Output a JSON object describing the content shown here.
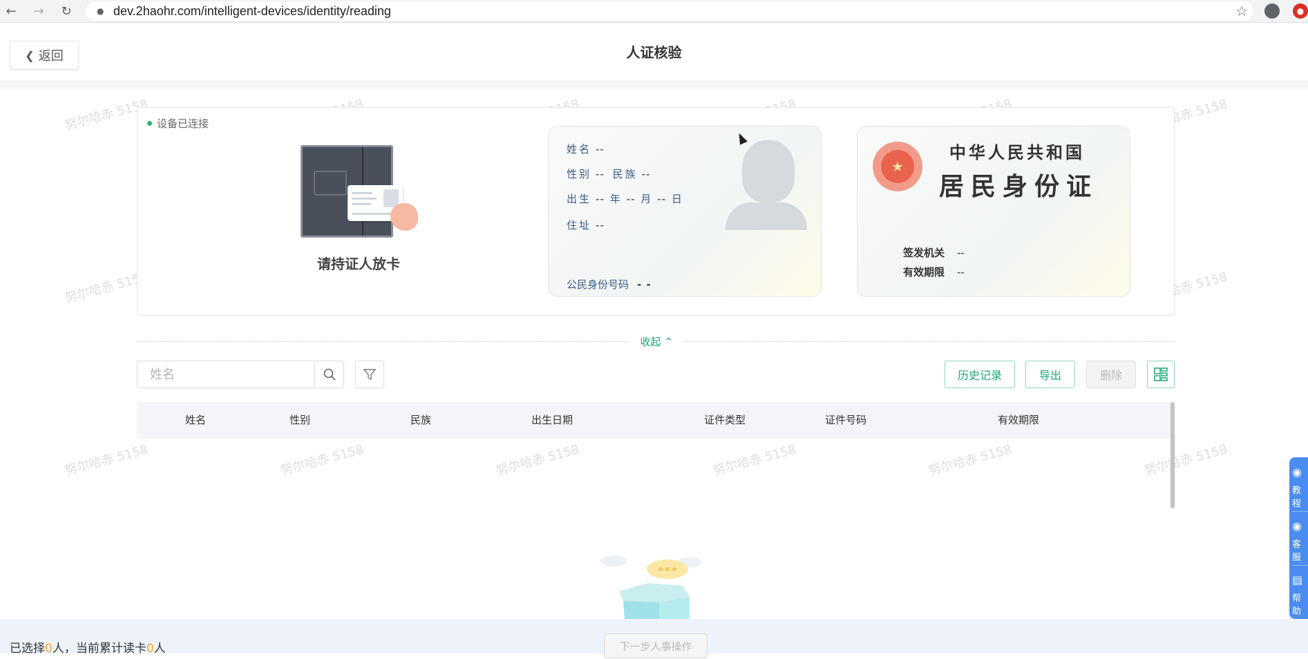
{
  "browser": {
    "url": "dev.2haohr.com/intelligent-devices/identity/reading",
    "back_icon": "arrow-left-icon",
    "forward_icon": "arrow-right-icon",
    "reload_icon": "reload-icon",
    "star_icon": "star-icon"
  },
  "header": {
    "back_label": "返回",
    "title": "人证核验"
  },
  "watermark": "努尔哈赤 5158",
  "reader": {
    "device_status": "设备已连接",
    "place_card_tip": "请持证人放卡",
    "front": {
      "name_label": "姓名",
      "name_value": "--",
      "gender_label": "性别",
      "gender_value": "--",
      "ethnicity_label": "民族",
      "ethnicity_value": "--",
      "birth_label": "出生",
      "birth_year": "--",
      "year_unit": "年",
      "birth_month": "--",
      "month_unit": "月",
      "birth_day": "--",
      "day_unit": "日",
      "address_label": "住址",
      "address_value": "--",
      "id_label": "公民身份号码",
      "id_value": "- -"
    },
    "back": {
      "country": "中华人民共和国",
      "card_title": "居民身份证",
      "authority_label": "签发机关",
      "authority_value": "--",
      "validity_label": "有效期限",
      "validity_value": "--"
    }
  },
  "collapse_label": "收起",
  "toolbar": {
    "search_placeholder": "姓名",
    "history_label": "历史记录",
    "export_label": "导出",
    "delete_label": "删除"
  },
  "table": {
    "columns": [
      "姓名",
      "性别",
      "民族",
      "出生日期",
      "证件类型",
      "证件号码",
      "有效期限"
    ]
  },
  "footer": {
    "selected_prefix": "已选择",
    "selected_count": "0",
    "selected_unit": "人，当前累计读卡",
    "read_count": "0",
    "read_unit": "人",
    "next_label": "下一步人事操作"
  },
  "side_panel": {
    "items": [
      "教程",
      "客服",
      "帮助"
    ]
  },
  "colors": {
    "accent": "#19a974",
    "count": "#f5a623",
    "side_panel": "#4a8cf0"
  }
}
